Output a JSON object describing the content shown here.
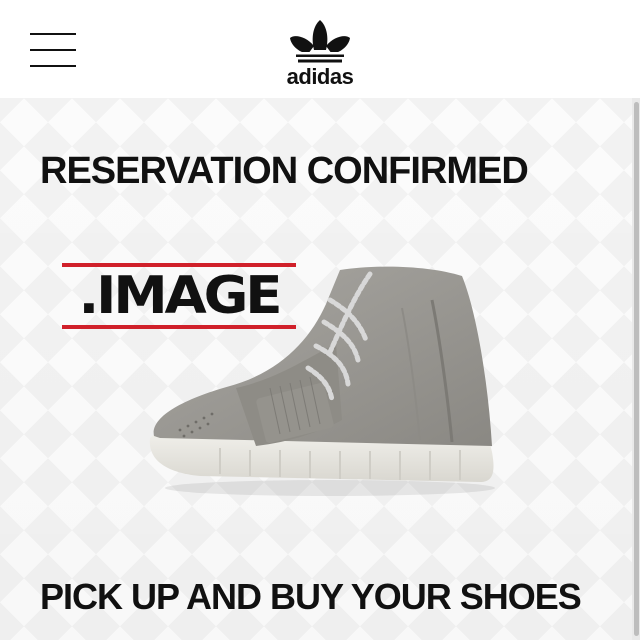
{
  "header": {
    "logo_text": "adidas"
  },
  "main": {
    "title": "RESERVATION CONFIRMED",
    "watermark_text": ".IMAGE",
    "cta_text": "PICK UP AND BUY YOUR SHOES"
  },
  "colors": {
    "accent_red": "#d0202a",
    "text": "#111111"
  },
  "icons": {
    "menu": "hamburger-menu-icon",
    "logo": "adidas-trefoil-logo",
    "product": "sneaker-image"
  }
}
